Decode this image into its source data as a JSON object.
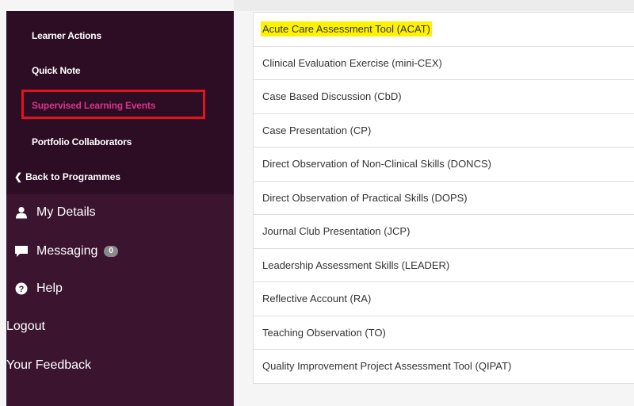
{
  "sidebar": {
    "subnav": [
      {
        "label": "Learner Actions",
        "active": false
      },
      {
        "label": "Quick Note",
        "active": false
      },
      {
        "label": "Supervised Learning Events",
        "active": true
      },
      {
        "label": "Portfolio Collaborators",
        "active": false
      }
    ],
    "back_label": "Back to Programmes",
    "main": [
      {
        "label": "My Details",
        "icon": "user-icon"
      },
      {
        "label": "Messaging",
        "icon": "comment-icon",
        "badge": "0"
      },
      {
        "label": "Help",
        "icon": "help-icon"
      },
      {
        "label": "Logout",
        "icon": ""
      },
      {
        "label": "Your Feedback",
        "icon": ""
      }
    ]
  },
  "event_types": [
    {
      "label": "Acute Care Assessment Tool (ACAT)",
      "highlighted": true
    },
    {
      "label": "Clinical Evaluation Exercise (mini-CEX)"
    },
    {
      "label": "Case Based Discussion (CbD)"
    },
    {
      "label": "Case Presentation (CP)"
    },
    {
      "label": "Direct Observation of Non-Clinical Skills (DONCS)"
    },
    {
      "label": "Direct Observation of Practical Skills (DOPS)"
    },
    {
      "label": "Journal Club Presentation (JCP)"
    },
    {
      "label": "Leadership Assessment Skills (LEADER)"
    },
    {
      "label": "Reflective Account (RA)"
    },
    {
      "label": "Teaching Observation (TO)"
    },
    {
      "label": "Quality Improvement Project Assessment Tool (QIPAT)"
    }
  ],
  "colors": {
    "sidebar_bg": "#3b1530",
    "subnav_bg": "#2c0d23",
    "active_text": "#d9338b",
    "highlight_box": "#e0141f",
    "text_highlight": "#fff200"
  }
}
